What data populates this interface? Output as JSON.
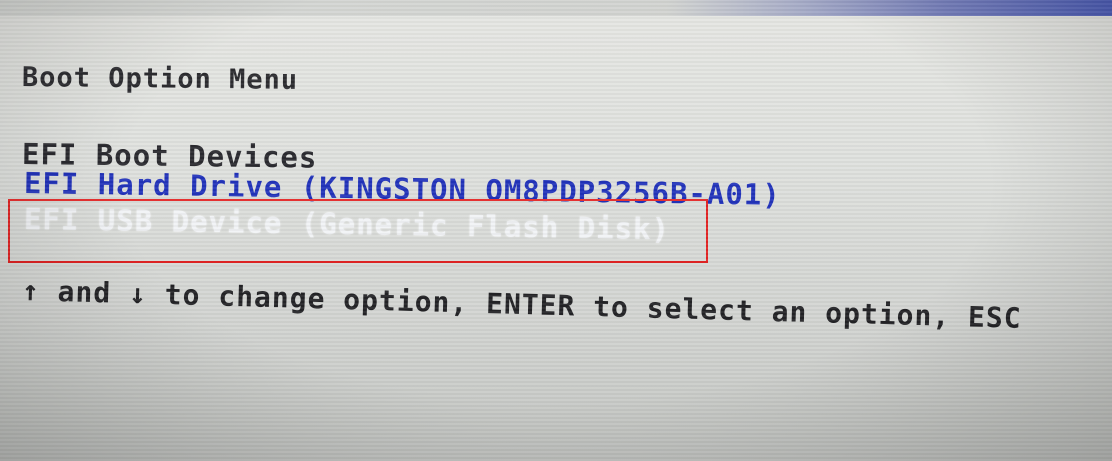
{
  "boot_menu": {
    "title": "Boot Option Menu",
    "section_header": "EFI Boot Devices",
    "options": [
      {
        "label": "EFI Hard Drive (KINGSTON OM8PDP3256B-A01)",
        "color": "#2233bb",
        "selected": false
      },
      {
        "label": "EFI USB Device (Generic Flash Disk)",
        "color": "#f1f3f6",
        "selected": true
      }
    ],
    "help_text": "↑ and ↓ to change option, ENTER to select an option, ESC"
  },
  "annotation": {
    "highlight_color": "#e32424"
  }
}
